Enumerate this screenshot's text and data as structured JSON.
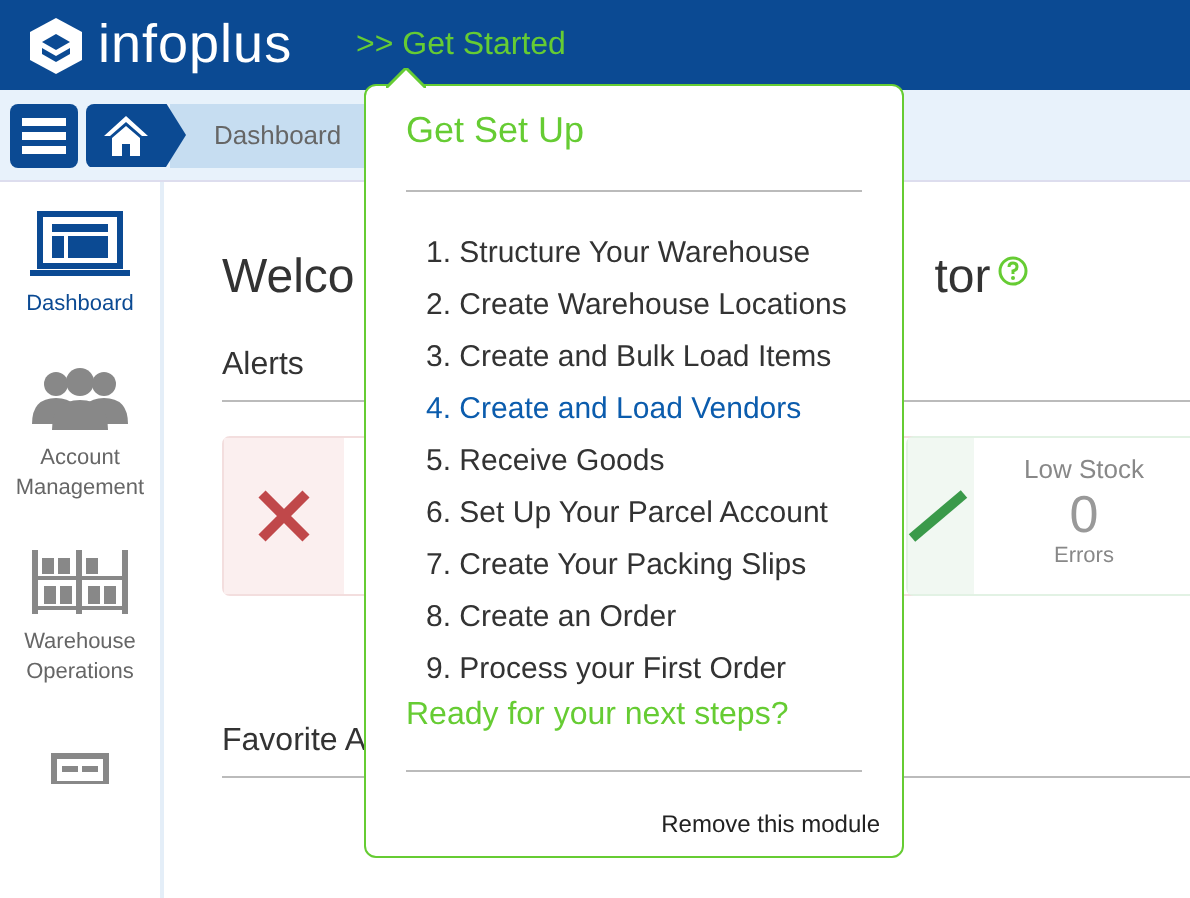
{
  "header": {
    "logo_text": "infoplus",
    "get_started": ">> Get Started"
  },
  "breadcrumb": {
    "items": [
      {
        "label": "Dashboard"
      }
    ]
  },
  "sidebar": {
    "items": [
      {
        "label": "Dashboard",
        "kind": "laptop",
        "selected": true
      },
      {
        "label": "Account Management",
        "kind": "people",
        "selected": false
      },
      {
        "label": "Warehouse Operations",
        "kind": "shelves",
        "selected": false
      },
      {
        "kind": "form",
        "selected": false
      }
    ]
  },
  "main": {
    "title_start": "Welco",
    "title_end": "tor",
    "alerts_heading": "Alerts",
    "favorites_heading": "Favorite A",
    "alert_cards": [
      {
        "kind": "error"
      },
      {
        "kind": "ok",
        "title": "Low Stock",
        "value": "0",
        "caption": "Errors"
      }
    ]
  },
  "popover": {
    "title": "Get Set Up",
    "steps": [
      {
        "label": "1. Structure Your Warehouse",
        "selected": false
      },
      {
        "label": "2. Create Warehouse Locations",
        "selected": false
      },
      {
        "label": "3. Create and Bulk Load Items",
        "selected": false
      },
      {
        "label": "4. Create and Load Vendors",
        "selected": true
      },
      {
        "label": "5. Receive Goods",
        "selected": false
      },
      {
        "label": "6. Set Up Your Parcel Account",
        "selected": false
      },
      {
        "label": "7. Create Your Packing Slips",
        "selected": false
      },
      {
        "label": "8. Create an Order",
        "selected": false
      },
      {
        "label": "9. Process your First Order",
        "selected": false
      }
    ],
    "next_steps": "Ready for your next steps?",
    "remove": "Remove this module"
  }
}
